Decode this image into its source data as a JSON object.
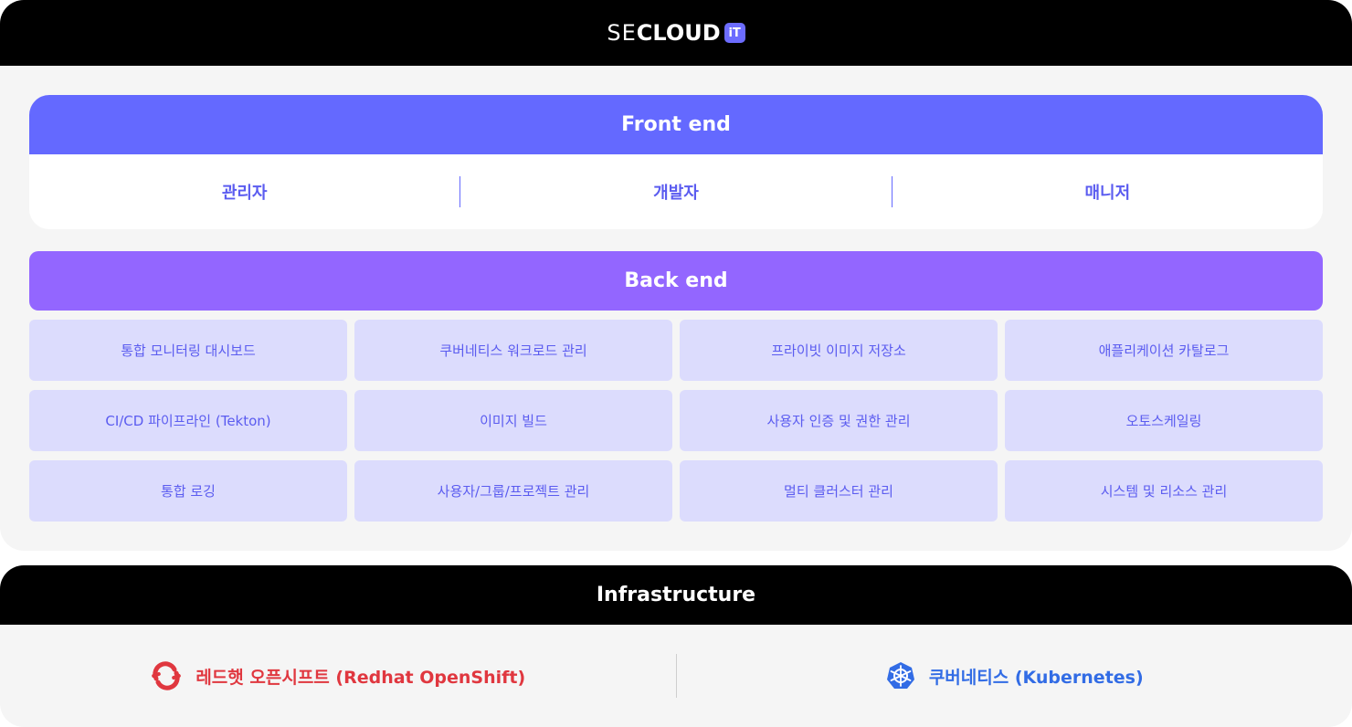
{
  "header": {
    "logo": {
      "part1": "SE",
      "part2": "CLOUD",
      "badge": "iT"
    }
  },
  "frontend": {
    "title": "Front end",
    "roles": [
      "관리자",
      "개발자",
      "매니저"
    ]
  },
  "backend": {
    "title": "Back end",
    "modules": [
      "통합 모니터링 대시보드",
      "쿠버네티스 워크로드 관리",
      "프라이빗 이미지 저장소",
      "애플리케이션 카탈로그",
      "CI/CD 파이프라인 (Tekton)",
      "이미지 빌드",
      "사용자 인증 및 권한 관리",
      "오토스케일링",
      "통합 로깅",
      "사용자/그룹/프로젝트 관리",
      "멀티 클러스터 관리",
      "시스템 및 리소스 관리"
    ]
  },
  "infrastructure": {
    "title": "Infrastructure",
    "items": [
      {
        "label": "레드햇 오픈시프트 (Redhat OpenShift)",
        "icon": "openshift-icon",
        "color": "#e0373f"
      },
      {
        "label": "쿠버네티스 (Kubernetes)",
        "icon": "kubernetes-icon",
        "color": "#326ce5"
      }
    ]
  },
  "colors": {
    "frontend_accent": "#6469ff",
    "backend_accent": "#9366ff",
    "module_bg": "#dcdcfd",
    "module_text": "#5b5cf0",
    "header_bg": "#000000",
    "logo_badge": "#6c6cff"
  }
}
